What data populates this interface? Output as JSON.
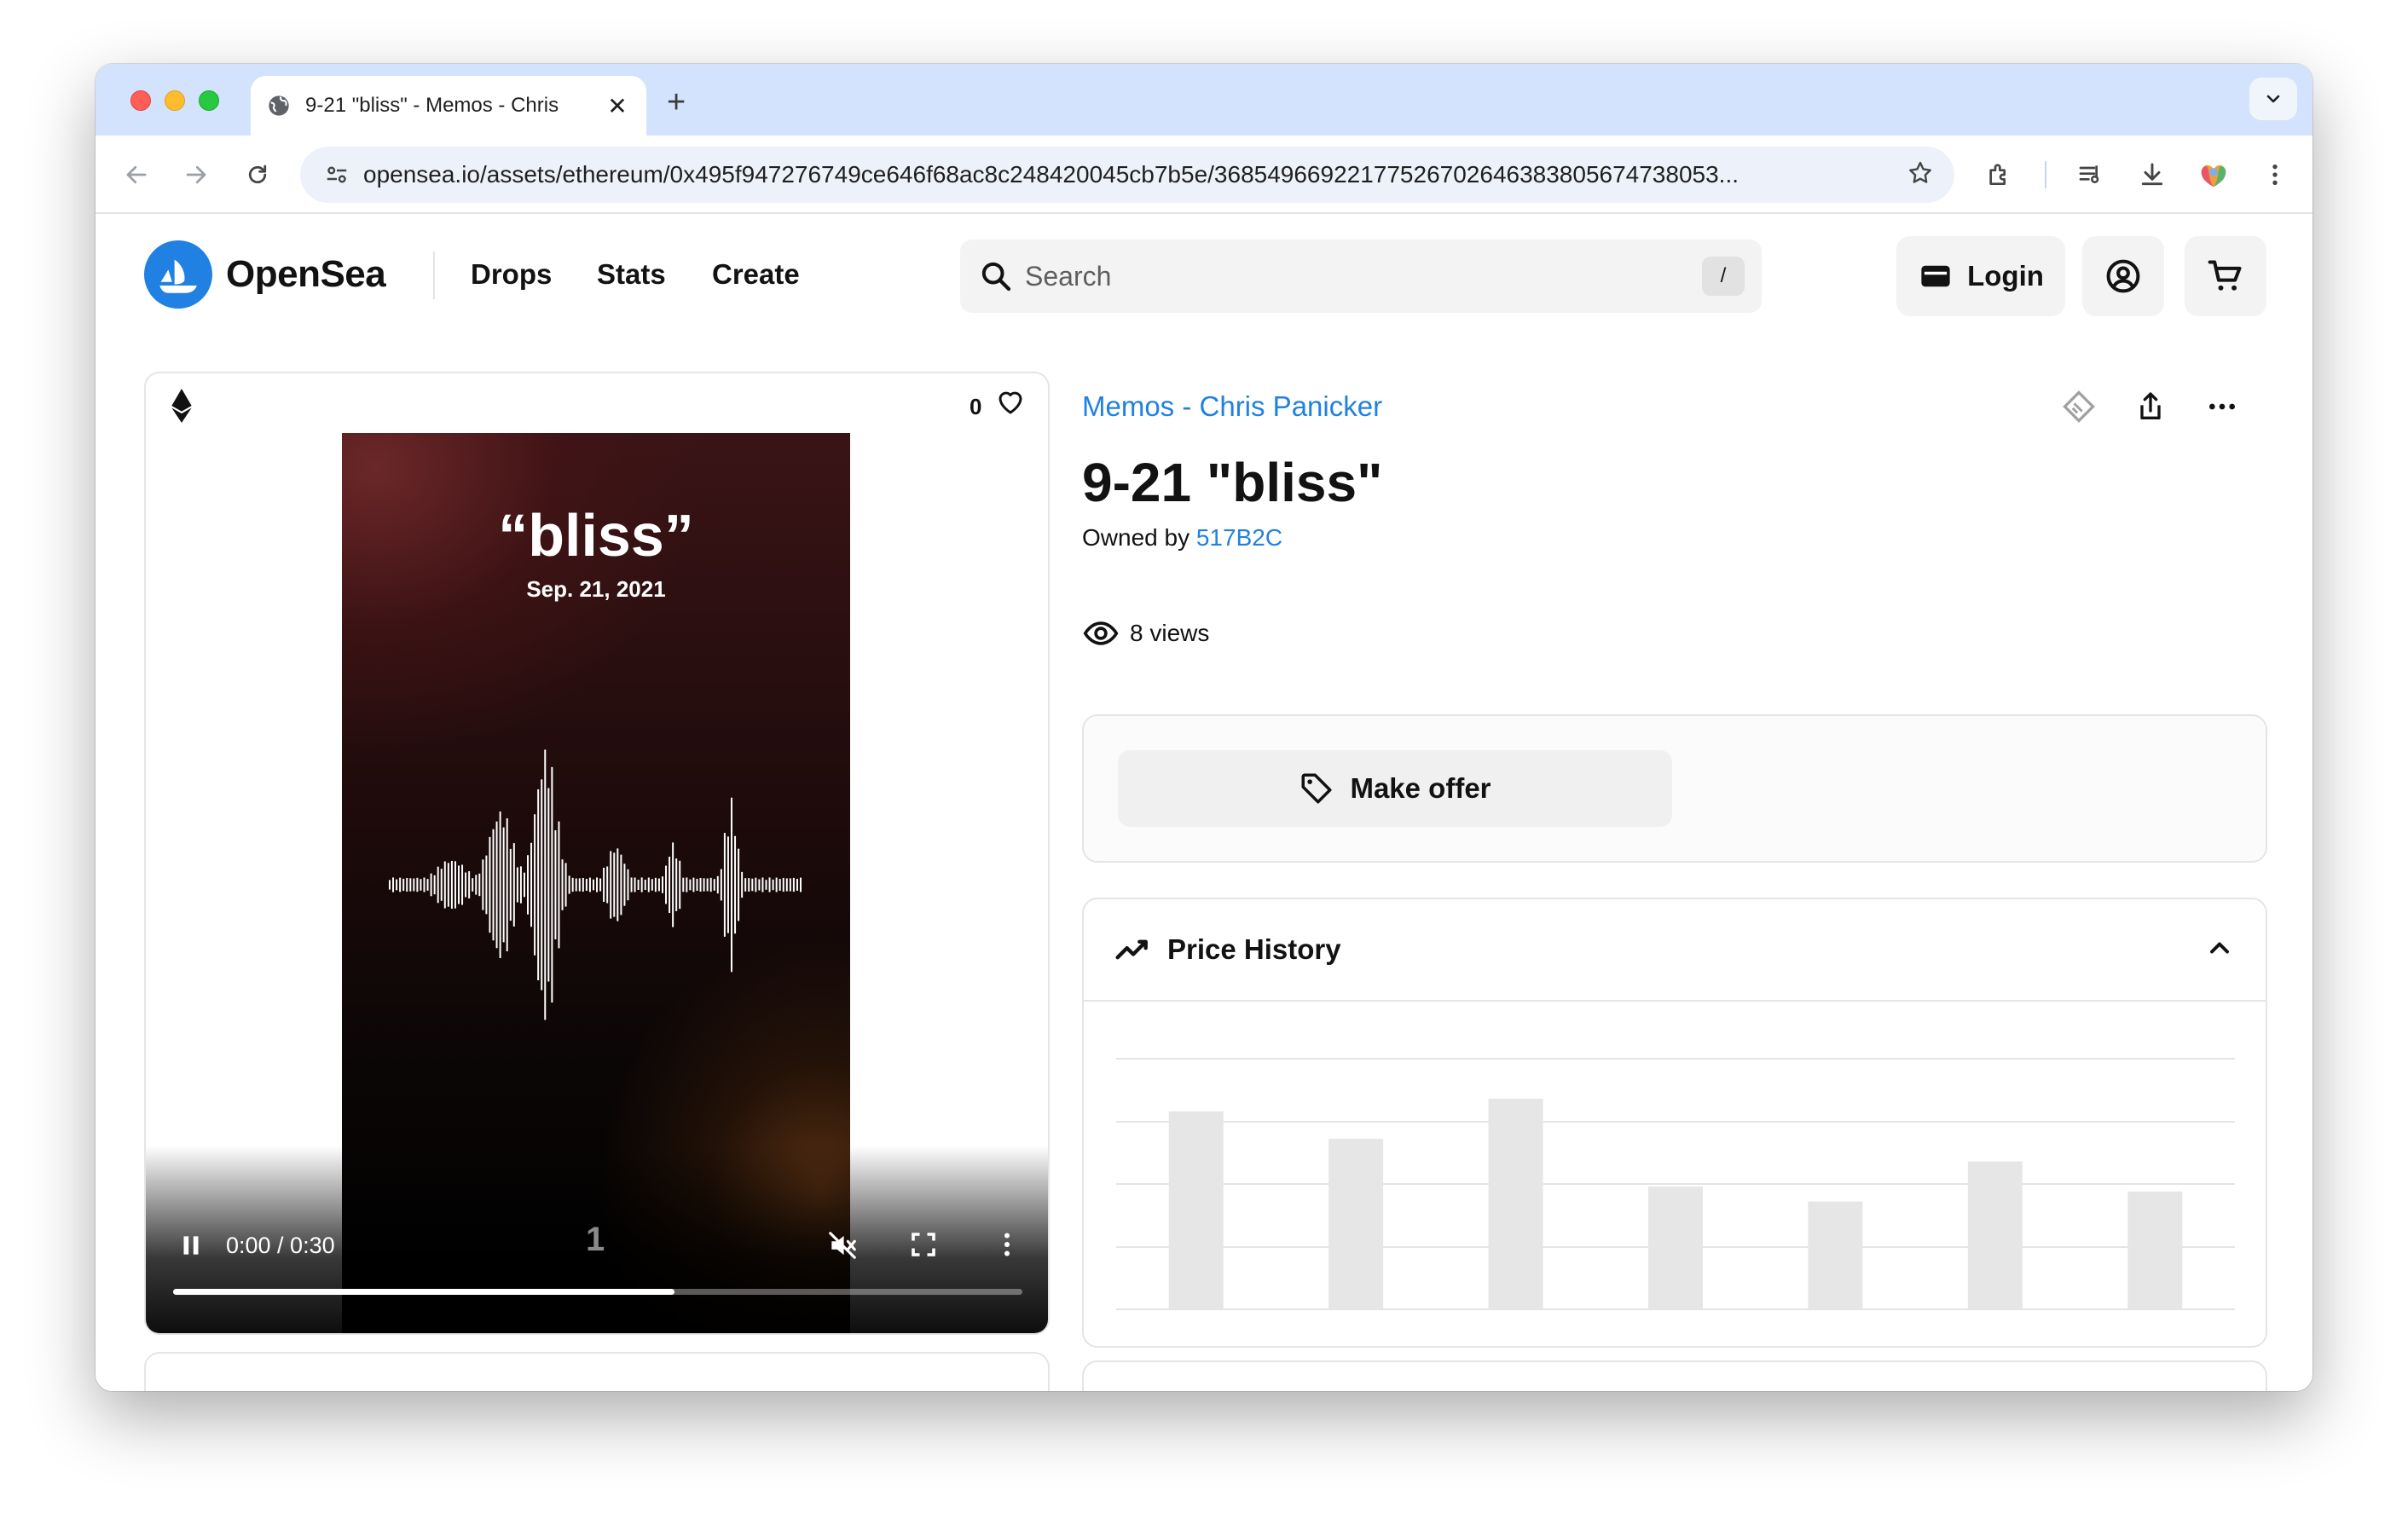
{
  "browser": {
    "tab_title": "9-21 \"bliss\" - Memos - Chris",
    "new_tab_symbol": "+",
    "url": "opensea.io/assets/ethereum/0x495f947276749ce646f68ac8c248420045cb7b5e/36854966922177526702646383805674738053..."
  },
  "header": {
    "logo_text": "OpenSea",
    "nav": [
      "Drops",
      "Stats",
      "Create"
    ],
    "search_placeholder": "Search",
    "search_shortcut": "/",
    "login_label": "Login"
  },
  "media": {
    "favorites_count": "0",
    "poster_title": "“bliss”",
    "poster_date": "Sep. 21, 2021",
    "time_display": "0:00 / 0:30",
    "page_number": "1",
    "progress_fraction": 0.59
  },
  "item": {
    "collection": "Memos - Chris Panicker",
    "title": "9-21 \"bliss\"",
    "owned_by_label": "Owned by",
    "owner": "517B2C",
    "views": "8 views",
    "make_offer_label": "Make offer",
    "price_history_label": "Price History"
  },
  "colors": {
    "brand_blue": "#2081e2",
    "placeholder_bar": "#e6e6e6"
  },
  "price_history_placeholder_levels": [
    0.79,
    0.68,
    0.84,
    0.49,
    0.43,
    0.59,
    0.47
  ]
}
